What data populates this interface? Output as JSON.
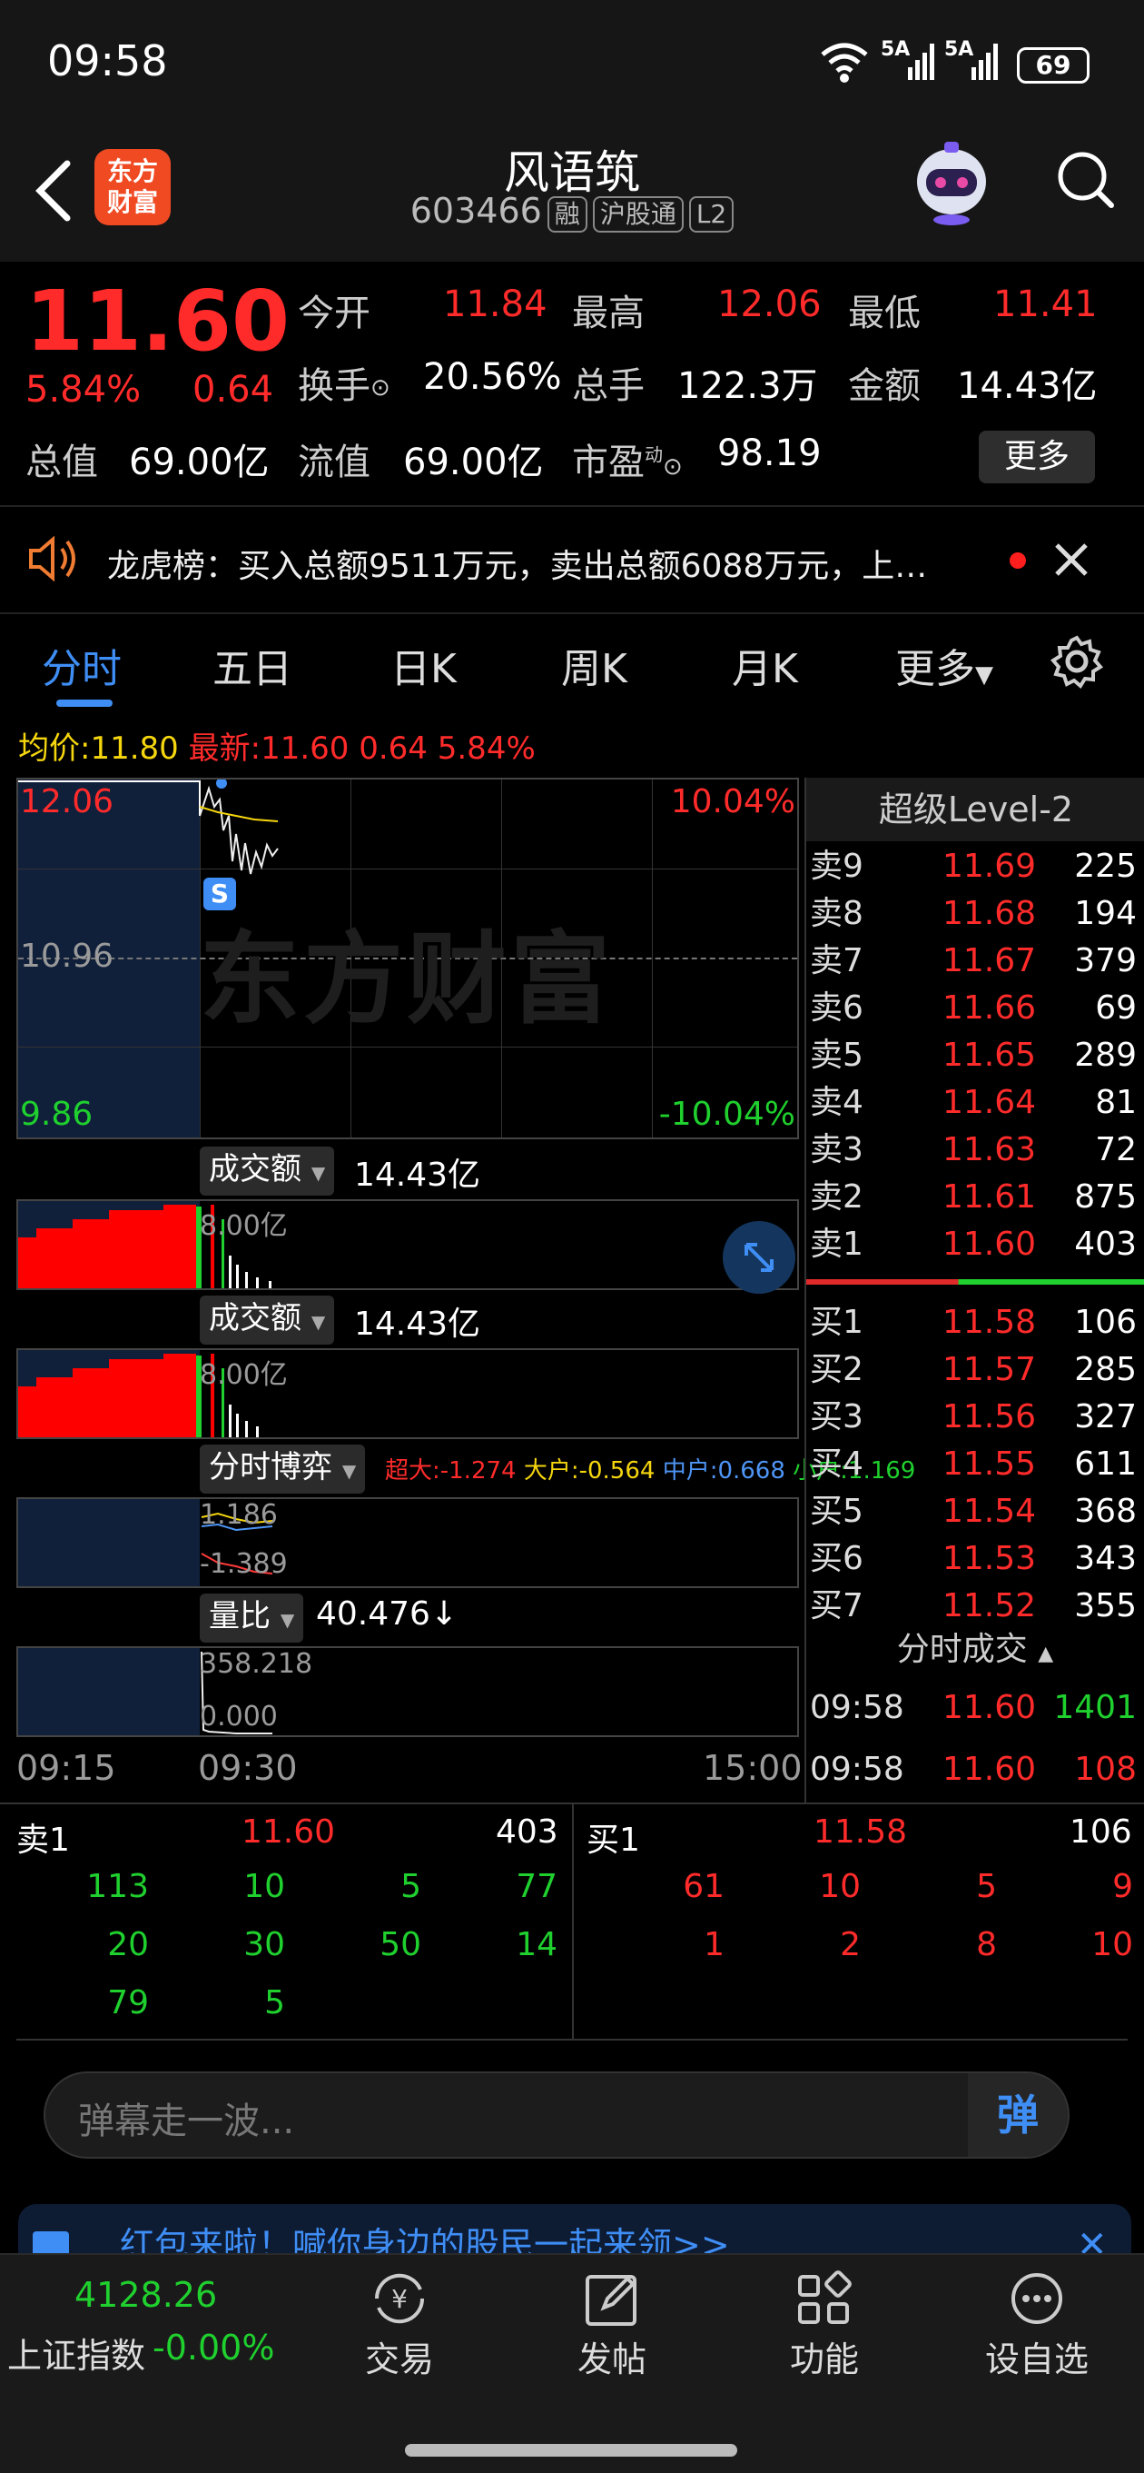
{
  "status_bar": {
    "time": "09:58",
    "battery": "69",
    "net1": "5A",
    "net2": "5A"
  },
  "header": {
    "title": "风语筑",
    "code": "603466",
    "tags": [
      "融",
      "沪股通",
      "L2"
    ],
    "logo_text": "东方\n财富",
    "logo_l1": "东方",
    "logo_l2": "财富"
  },
  "quote": {
    "price": "11.60",
    "change_pct": "5.84%",
    "change": "0.64",
    "open_label": "今开",
    "open": "11.84",
    "high_label": "最高",
    "high": "12.06",
    "low_label": "最低",
    "low": "11.41",
    "turnover_label": "换手",
    "turnover": "20.56%",
    "volume_label": "总手",
    "volume": "122.3万",
    "amount_label": "金额",
    "amount": "14.43亿",
    "mktcap_label": "总值",
    "mktcap": "69.00亿",
    "float_label": "流值",
    "float": "69.00亿",
    "pe_label": "市盈",
    "pe_sup": "动",
    "pe": "98.19",
    "more_button": "更多"
  },
  "notice": {
    "text": "龙虎榜：买入总额9511万元，卖出总额6088万元，上…"
  },
  "tabs": [
    {
      "label": "分时"
    },
    {
      "label": "五日"
    },
    {
      "label": "日K"
    },
    {
      "label": "周K"
    },
    {
      "label": "月K"
    },
    {
      "label": "更多"
    }
  ],
  "chart": {
    "avg_label": "均价:",
    "avg": "11.80",
    "latest_label": "最新:",
    "latest": "11.60 0.64 5.84%",
    "y_top": "12.06",
    "y_mid": "10.96",
    "y_bot": "9.86",
    "pct_top": "10.04%",
    "pct_bot": "-10.04%",
    "watermark": "东方财富",
    "s_marker": "S",
    "ind1_label": "成交额",
    "ind1_value": "14.43亿",
    "ind1_axis": "8.00亿",
    "ind2_label": "成交额",
    "ind2_value": "14.43亿",
    "ind2_axis": "8.00亿",
    "ind3_label": "分时博弈",
    "ind3_big": "超大:-1.274",
    "ind3_large": "大户:-0.564",
    "ind3_mid": "中户:0.668",
    "ind3_small": "小户:1.169",
    "ind3_axis_top": "1.186",
    "ind3_axis_bot": "-1.389",
    "ind4_label": "量比",
    "ind4_value": "40.476↓",
    "ind4_axis_top": "358.218",
    "ind4_axis_bot": "0.000",
    "time_start": "09:15",
    "time_open": "09:30",
    "time_end": "15:00"
  },
  "orderbook": {
    "title": "超级Level-2",
    "asks": [
      {
        "label": "卖9",
        "price": "11.69",
        "qty": "225"
      },
      {
        "label": "卖8",
        "price": "11.68",
        "qty": "194"
      },
      {
        "label": "卖7",
        "price": "11.67",
        "qty": "379"
      },
      {
        "label": "卖6",
        "price": "11.66",
        "qty": "69"
      },
      {
        "label": "卖5",
        "price": "11.65",
        "qty": "289"
      },
      {
        "label": "卖4",
        "price": "11.64",
        "qty": "81"
      },
      {
        "label": "卖3",
        "price": "11.63",
        "qty": "72"
      },
      {
        "label": "卖2",
        "price": "11.61",
        "qty": "875"
      },
      {
        "label": "卖1",
        "price": "11.60",
        "qty": "403"
      }
    ],
    "bids": [
      {
        "label": "买1",
        "price": "11.58",
        "qty": "106"
      },
      {
        "label": "买2",
        "price": "11.57",
        "qty": "285"
      },
      {
        "label": "买3",
        "price": "11.56",
        "qty": "327"
      },
      {
        "label": "买4",
        "price": "11.55",
        "qty": "611"
      },
      {
        "label": "买5",
        "price": "11.54",
        "qty": "368"
      },
      {
        "label": "买6",
        "price": "11.53",
        "qty": "343"
      },
      {
        "label": "买7",
        "price": "11.52",
        "qty": "355"
      }
    ],
    "trades_title": "分时成交",
    "trades": [
      {
        "time": "09:58",
        "price": "11.60",
        "qty": "1401"
      },
      {
        "time": "09:58",
        "price": "11.60",
        "qty": "108"
      }
    ]
  },
  "queue": {
    "sell_label": "卖1",
    "sell_price": "11.60",
    "sell_total": "403",
    "sell_orders": [
      "113",
      "10",
      "5",
      "77",
      "20",
      "30",
      "50",
      "14",
      "79",
      "5"
    ],
    "buy_label": "买1",
    "buy_price": "11.58",
    "buy_total": "106",
    "buy_orders": [
      "61",
      "10",
      "5",
      "9",
      "1",
      "2",
      "8",
      "10"
    ]
  },
  "danmu": {
    "placeholder": "弹幕走一波...",
    "button": "弹"
  },
  "promo": {
    "text": "红包来啦！喊你身边的股民一起来领>>"
  },
  "bottom_nav": {
    "index_value": "4128.26",
    "index_name": "上证指数",
    "index_change": "-0.00%",
    "items": [
      {
        "label": "交易"
      },
      {
        "label": "发帖"
      },
      {
        "label": "功能"
      },
      {
        "label": "设自选"
      }
    ]
  }
}
